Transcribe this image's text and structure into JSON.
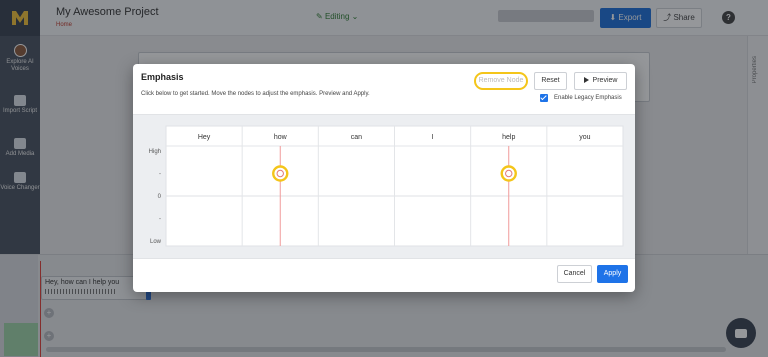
{
  "app": {
    "project_title": "My Awesome Project",
    "breadcrumb": "Home",
    "status": "Editing",
    "export_label": "Export",
    "share_label": "Share",
    "help_glyph": "?",
    "right_rail_label": "Properties"
  },
  "sidebar": {
    "items": [
      {
        "label": "Explore AI Voices",
        "icon": "avatar-icon"
      },
      {
        "label": "Import Script",
        "icon": "import-icon"
      },
      {
        "label": "Add Media",
        "icon": "media-icon"
      },
      {
        "label": "Voice Changer",
        "icon": "voice-changer-icon"
      }
    ]
  },
  "timeline": {
    "clip_text": "Hey, how can I help you",
    "add_glyph": "+"
  },
  "modal": {
    "title": "Emphasis",
    "description": "Click below to get started. Move the nodes to adjust the emphasis. Preview and Apply.",
    "remove_node_label": "Remove Node",
    "reset_label": "Reset",
    "preview_label": "Preview",
    "legacy_label": "Enable Legacy Emphasis",
    "legacy_checked": true,
    "cancel_label": "Cancel",
    "apply_label": "Apply",
    "highlight_color": "#f4c51a",
    "accent_color": "#1e73e8"
  },
  "emphasis_chart": {
    "words": [
      "Hey",
      "how",
      "can",
      "I",
      "help",
      "you"
    ],
    "y_labels": [
      "High",
      "-",
      "0",
      "-",
      "Low"
    ],
    "nodes": [
      {
        "word": "how",
        "level": "-"
      },
      {
        "word": "help",
        "level": "-"
      }
    ]
  }
}
